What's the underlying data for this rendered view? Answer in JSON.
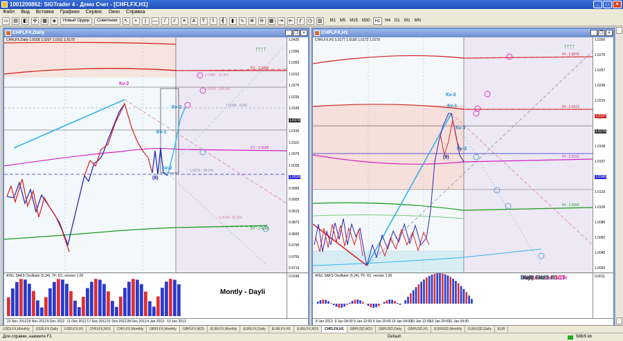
{
  "app": {
    "title": "1001200862: SIGTrader 4 - Демо Счет - [CHFLFX,H1]"
  },
  "menu": [
    "Файл",
    "Вид",
    "Вставка",
    "Графики",
    "Сервис",
    "Окно",
    "Справка"
  ],
  "toolbar": {
    "new_order": "Новый Ордер",
    "advisors": "Советники",
    "timeframes": [
      "M1",
      "M5",
      "M15",
      "M30",
      "H1",
      "H4",
      "D1",
      "W1",
      "MN"
    ],
    "active_tf": "H1"
  },
  "left": {
    "title": "CHFLFX,Daily",
    "info": "CHFLFX,Daily  1.0168 1.0207 1.0161 1.0179",
    "osc_label": "ATEL SAKS Oscillator (5,34), TF: D1, version 1.00",
    "note": "Montly - Dayli",
    "price_labels": [
      "1.0435",
      "1.0395",
      "1.0355",
      "1.0315",
      "1.0275",
      "1.0235",
      "1.0195",
      "1.0179",
      "1.0155",
      "1.0115",
      "1.0075",
      "1.0035",
      "1.0018",
      "0.9995",
      "0.9955",
      "0.9915",
      "0.9875",
      "0.9835",
      "0.9795",
      "0.9755",
      "0.9715"
    ],
    "osc_value": "0.0246",
    "dates": [
      "22 Nov 2012",
      "29 Nov 2012",
      "5 Dec 2012",
      "11 Dec 2012",
      "17 Dec 2012",
      "21 Dec 2012",
      "28 Dec 2012",
      "4 Jan 2013",
      "10 Jan 2013"
    ],
    "waves": [
      "Кv-2",
      "Кv-1",
      "Кv-3",
      "Кv-2",
      "(8)"
    ],
    "levels": [
      "DT - 1.0449",
      "DT - 1.0089",
      "1.0098 - 0.0%",
      "1.0073 - 38.2%",
      "1.0034 - 100.0%",
      "1.0080 - 61.8%",
      "1.0014 - 81.8%",
      "DT - 1.0065"
    ],
    "arrows": "↑↑↑↑"
  },
  "right": {
    "title": "CHFLFX,H1",
    "info": "CHFLFX,H1  1.0177 1.0180 1.0172 1.0179",
    "osc_label": "ATEL SAKS Oscillator (5,34), TF: H1, version 1.00",
    "notes": {
      "line1": "Факультет ГОСТ",
      "line2": "Dayli - H1",
      "line3": "CHFLFX 11.01.13г",
      "line4": "09:01 GMT+6"
    },
    "colors": {
      "line1": "#e01010",
      "line2": "#000000",
      "line3": "#c020c0",
      "line4": "#1a8a70"
    },
    "price_labels": [
      "1.0300",
      "1.0276",
      "1.0257",
      "1.0236",
      "1.0215",
      "1.0197",
      "1.0179",
      "1.0168",
      "1.0157",
      "1.0140",
      "1.0120",
      "1.0100",
      "1.0080",
      "1.0060",
      "1.0040",
      "1.0020"
    ],
    "osc_value": "0.0011",
    "dates": [
      "8 Jan 2013",
      "9 Jan 04:00",
      "9 Jan 12:00",
      "9 Jan 20:00",
      "10 Jan 04:00",
      "10 Jan 12:00",
      "10 Jan 20:00",
      "11 Jan 04:00"
    ],
    "waves": [
      "Кv-3",
      "Кv-1",
      "Кv-3",
      "Кv-2",
      "(9)"
    ],
    "levels": [
      "HI - 1.0279",
      "HI - 1.0213",
      "HI - 1.0151",
      "HI - 1.0094"
    ],
    "arrows": "↑↑↑↑"
  },
  "tabs": [
    "USDLFX,Monthly",
    "USDLFX,Daily",
    "USDLFX,H1",
    "CHFLFX,M15",
    "CHFLFX,Monthly",
    "GBPLFX,Monthly",
    "GBPLFX,M15",
    "EURLFX,Monthly",
    "EURLFX,Daily",
    "EURLFX,H1",
    "EURLFX,M15",
    "CHFLFX,H1",
    "GBPUSD,M15",
    "GBPUSD,Daily",
    "GBPUSD,H1",
    "EURUSD,Monthly",
    "EURUSD,Daily",
    "EUR"
  ],
  "active_tab": "CHFLFX,H1",
  "status": {
    "help": "Для справки, нажмите F1",
    "profile": "Default",
    "traffic": "588/9 kb"
  }
}
